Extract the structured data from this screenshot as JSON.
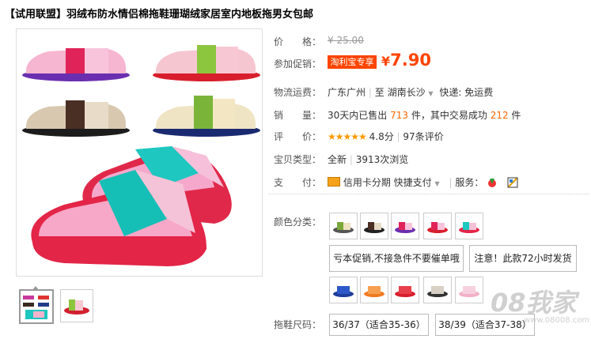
{
  "title": "【试用联盟】羽绒布防水情侣棉拖鞋珊瑚绒家居室内地板拖男女包邮",
  "price": {
    "label": "价　　格：",
    "currency": "¥",
    "value": "25.00"
  },
  "promo": {
    "label": "参加促销：",
    "tag": "淘利宝专享",
    "currency": "¥",
    "value": "7.90"
  },
  "shipping": {
    "label": "物流运费：",
    "from": "广东广州",
    "to_word": "至",
    "to": "湖南长沙",
    "method": "快递: 免运费"
  },
  "sales": {
    "label": "销　　量：",
    "prefix": "30天内已售出",
    "count": "713",
    "mid": "件，其中交易成功",
    "success": "212",
    "suffix": "件"
  },
  "rating": {
    "label": "评　　价：",
    "stars": "★★★★★",
    "score": "4.8分",
    "reviews": "97条评价"
  },
  "product_type": {
    "label": "宝贝类型：",
    "condition": "全新",
    "views": "3913次浏览"
  },
  "payment": {
    "label": "支　　付：",
    "credit": "信用卡分期",
    "quick": "快捷支付",
    "service_label": "服务："
  },
  "options": {
    "color_label": "颜色分类：",
    "color_swatches": [
      "swatch-1",
      "swatch-2",
      "swatch-3",
      "swatch-4",
      "swatch-5"
    ],
    "notice_1": "亏本促销,不接急件不要催单哦",
    "notice_2": "注意！此款72小时发货",
    "size_label": "拖鞋尺码：",
    "sizes": [
      "36/37（适合35-36）",
      "38/39（适合37-38）"
    ]
  },
  "watermark": {
    "text": "08我家",
    "url": "www.08008.com"
  },
  "colors": {
    "accent": "#ff4400",
    "price_orange": "#ff6600",
    "star": "#ff9900"
  }
}
